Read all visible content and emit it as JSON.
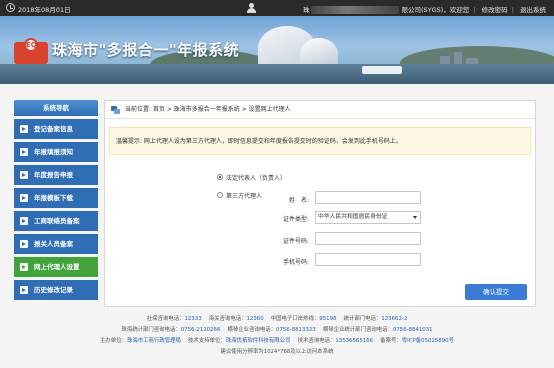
{
  "topbar": {
    "date": "2018年08月01日",
    "user_prefix": "珠",
    "user_suffix": "限公司(SYGS)，欢迎您",
    "change_password": "修改密码",
    "logout": "退出系统",
    "separator": "|"
  },
  "banner": {
    "logo_text": "EQ",
    "title": "珠海市\"多报合一\"年报系统"
  },
  "sidebar": {
    "heading": "系统导航",
    "items": [
      {
        "label": "登记备案信息"
      },
      {
        "label": "年报填报须知"
      },
      {
        "label": "年度报告申报"
      },
      {
        "label": "年报模板下载"
      },
      {
        "label": "工商联络员备案"
      },
      {
        "label": "报关人员备案"
      },
      {
        "label": "网上代理人设置",
        "active": true
      },
      {
        "label": "历史修改记录"
      }
    ],
    "colors": {
      "normal": "#2f6eb5",
      "active": "#43a33b"
    }
  },
  "main": {
    "breadcrumb": "当前位置: 首页 > 珠海市多报合一年报系统 > 设置网上代理人",
    "notice": "温馨提示: 网上代理人设为第三方代理人，即时信息提交和年度报告提交时的验证码，会发到此手机号码上。",
    "roles": {
      "legal_rep": "法定代表人（负责人）",
      "third_party": "第三方代理人",
      "selected": "legal_rep"
    },
    "form": {
      "name_label": "姓　名:",
      "name_value": "",
      "id_type_label": "证件类型:",
      "id_type_value": "中华人民共和国居民身份证",
      "id_number_label": "证件号码:",
      "id_number_value": "",
      "phone_label": "手机号码:",
      "phone_value": ""
    },
    "submit": "确认提交"
  },
  "footer": {
    "line1": [
      {
        "label": "社保咨询电话：",
        "value": "12333"
      },
      {
        "label": "海关咨询电话：",
        "value": "12360"
      },
      {
        "label": "中国电子口岸热线：",
        "value": "95198"
      },
      {
        "label": "统计部门电话：",
        "value": "123662-2"
      }
    ],
    "line2": [
      {
        "label": "珠海统计部门咨询电话：",
        "value": "0756-2120266"
      },
      {
        "label": "横琴企业咨询电话：",
        "value": "0756-8813323"
      },
      {
        "label": "横琴企业统计部门咨询电话：",
        "value": "0756-8841031"
      }
    ],
    "line3": [
      {
        "label": "主办单位：",
        "value": "珠海市工商行政管理局"
      },
      {
        "label": "技术支持单位：",
        "value": "珠海优拓软件科技有限公司"
      },
      {
        "label": "技术咨询电话：",
        "value": "13536565166"
      },
      {
        "label": "备案号：",
        "value": "粤ICP备05025890号"
      }
    ],
    "line4": "建议使用分辨率为1024*768及以上访问本系统"
  }
}
